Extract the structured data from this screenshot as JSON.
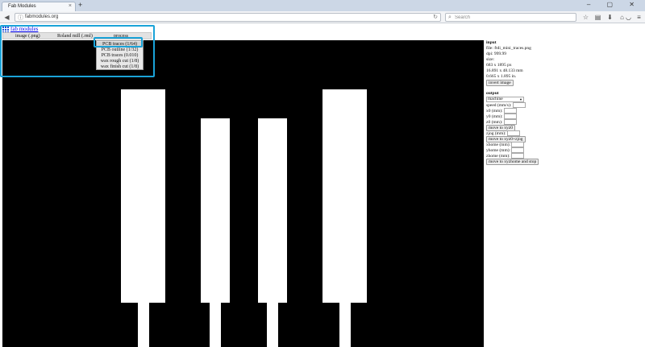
{
  "browser": {
    "tab_title": "Fab Modules",
    "tab_close": "×",
    "new_tab": "+",
    "url": "fabmodules.org",
    "search_placeholder": "Search",
    "window_controls": "– ▢ ✕"
  },
  "page": {
    "brand_link": "fab modules",
    "menu": {
      "input": "image (.png)",
      "output": "Roland mill (.rml)",
      "process": "process"
    },
    "process_options": [
      "PCB traces (1/64)",
      "PCB outline (1/32)",
      "PCB traces (0.010)",
      "wax rough cut (1/8)",
      "wax finish cut (1/8)"
    ],
    "selected_process": "PCB traces (1/64)"
  },
  "panel": {
    "input_heading": "input",
    "file": "file: ftdi_mini_traces.png",
    "dpi": "dpi: 999.99",
    "size_label": "size:",
    "size_px": "683 x 1895 px",
    "size_mm": "16.891 x 48.133 mm",
    "size_in": "0.665 x 1.895 in.",
    "invert_button": "invert image",
    "output_heading": "output",
    "machine_select": "machine",
    "speed_label": "speed (mm/s):",
    "x0_label": "x0 (mm):",
    "y0_label": "y0 (mm):",
    "z0_label": "z0 (mm):",
    "move_xyz0_button": "move to xyz0",
    "zjog_label": "zjog (mm):",
    "move_xyz0_zjog_button": "move to xyz0+zjog",
    "xhome_label": "xhome (mm):",
    "yhome_label": "yhome (mm):",
    "zhome_label": "zhome (mm):",
    "move_home_button": "move to xyzhome and stop"
  },
  "colors": {
    "highlight": "#1aa3d8",
    "link": "#0000ee",
    "viewer_bg": "#000000"
  }
}
